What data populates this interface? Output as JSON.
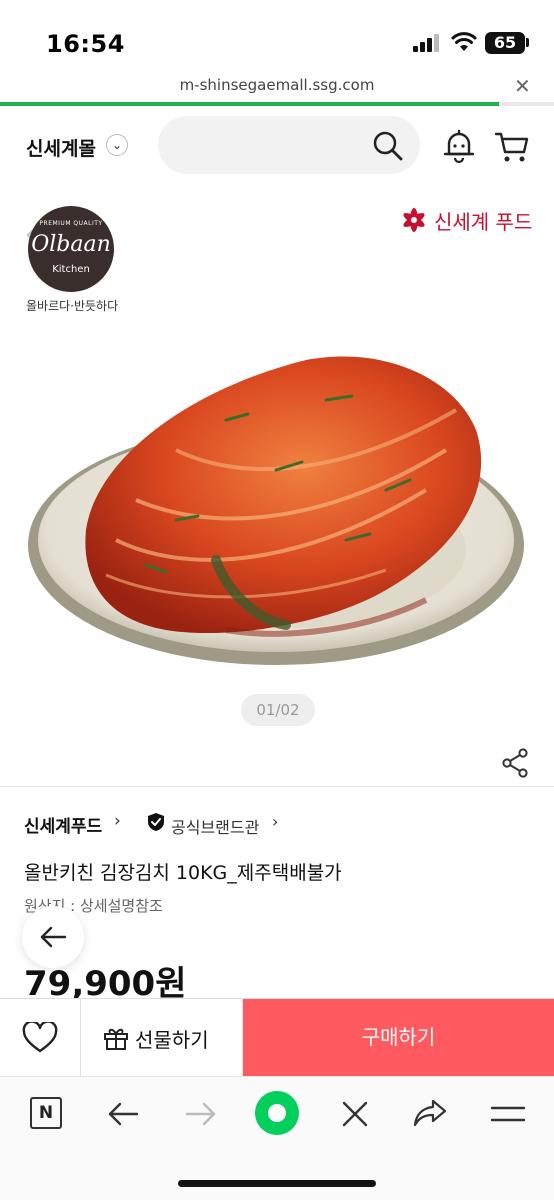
{
  "status_bar": {
    "time": "16:54",
    "battery": "65"
  },
  "browser": {
    "url": "m-shinsegaemall.ssg.com",
    "load_progress": 0.9
  },
  "header": {
    "brand": "신세계몰",
    "search_placeholder": ""
  },
  "hero": {
    "olbaan_top": "PREMIUM QUALITY",
    "olbaan_name": "Olbaan",
    "olbaan_sub": "Kitchen",
    "olbaan_tagline": "올바르다·반듯하다",
    "partner_brand": "신세계 푸드",
    "pager": "01/02"
  },
  "product": {
    "seller": "신세계푸드",
    "official_label": "공식브랜드관",
    "title": "올반키친 김장김치 10KG_제주택배불가",
    "origin": "원산지 : 상세설명참조",
    "price": "79,900원"
  },
  "actions": {
    "gift_label": "선물하기",
    "buy_label": "구매하기"
  },
  "browser_bar": {
    "n_label": "N"
  },
  "colors": {
    "buy": "#ff5a5f",
    "progress": "#1fb14a",
    "home": "#03cf5d",
    "brand_red": "#c8102e"
  },
  "icons": [
    "search-icon",
    "bell-icon",
    "cart-icon",
    "share-icon",
    "heart-icon",
    "gift-icon",
    "back-arrow-icon",
    "forward-arrow-icon",
    "close-icon",
    "menu-icon"
  ]
}
